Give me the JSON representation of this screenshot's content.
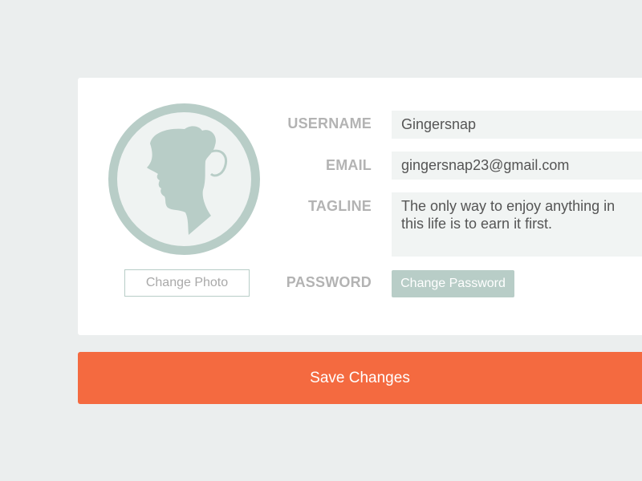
{
  "profile": {
    "avatar_icon": "woman-silhouette-cameo-icon",
    "change_photo_label": "Change Photo"
  },
  "form": {
    "username_label": "USERNAME",
    "username_value": "Gingersnap",
    "email_label": "EMAIL",
    "email_value": "gingersnap23@gmail.com",
    "tagline_label": "TAGLINE",
    "tagline_value": "The only way to enjoy anything in this life is to earn it first.",
    "password_label": "PASSWORD",
    "change_password_label": "Change Password"
  },
  "actions": {
    "save_label": "Save Changes"
  },
  "colors": {
    "background": "#ebeeee",
    "card": "#ffffff",
    "accent": "#f46a40",
    "sage": "#b8cdc7",
    "field_bg": "#f1f4f3",
    "label": "#b3b3b3"
  }
}
